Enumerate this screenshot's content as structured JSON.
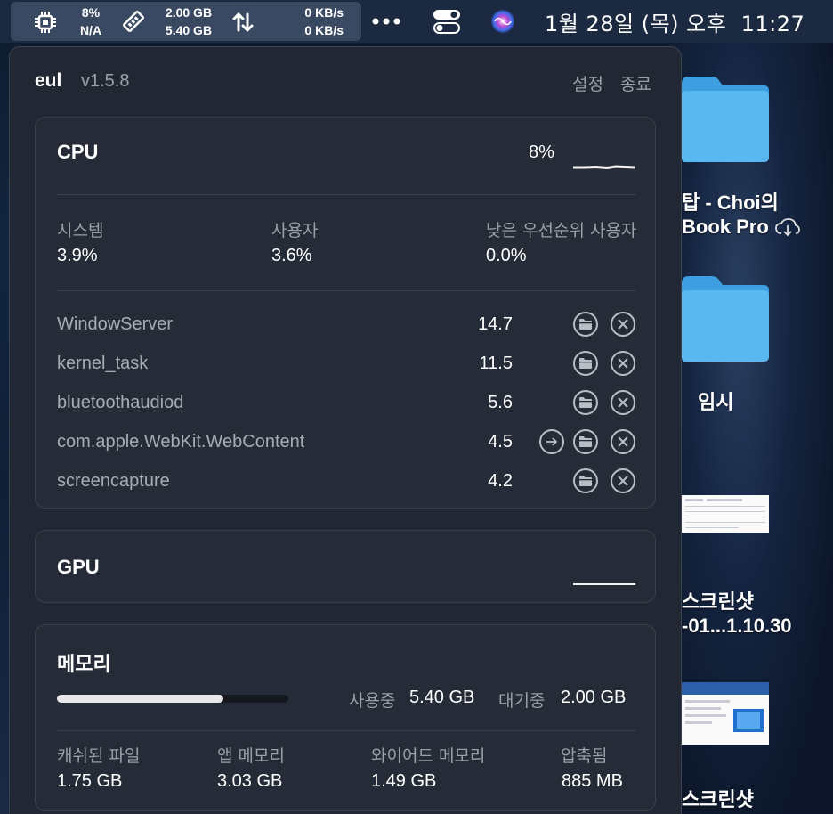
{
  "menubar": {
    "cpu_percent": "8%",
    "battery": "N/A",
    "memory_used": "2.00 GB",
    "memory_total": "5.40 GB",
    "net_up": "0 KB/s",
    "net_down": "0 KB/s",
    "clock": "1월 28일 (목) 오후  11:27"
  },
  "panel": {
    "app_name": "eul",
    "version": "v1.5.8",
    "settings_label": "설정",
    "quit_label": "종료"
  },
  "cpu": {
    "title": "CPU",
    "usage": "8%",
    "system_label": "시스템",
    "system_value": "3.9%",
    "user_label": "사용자",
    "user_value": "3.6%",
    "nice_label": "낮은 우선순위 사용자",
    "nice_value": "0.0%",
    "processes": [
      {
        "name": "WindowServer",
        "value": "14.7"
      },
      {
        "name": "kernel_task",
        "value": "11.5"
      },
      {
        "name": "bluetoothaudiod",
        "value": "5.6"
      },
      {
        "name": "com.apple.WebKit.WebContent",
        "value": "4.5"
      },
      {
        "name": "screencapture",
        "value": "4.2"
      }
    ]
  },
  "gpu": {
    "title": "GPU"
  },
  "memory": {
    "title": "메모리",
    "used_fraction": 0.72,
    "in_use_label": "사용중",
    "in_use_value": "5.40 GB",
    "standby_label": "대기중",
    "standby_value": "2.00 GB",
    "cached_label": "캐쉬된 파일",
    "cached_value": "1.75 GB",
    "app_label": "앱 메모리",
    "app_value": "3.03 GB",
    "wired_label": "와이어드 메모리",
    "wired_value": "1.49 GB",
    "compressed_label": "압축됨",
    "compressed_value": "885 MB"
  },
  "desktop": {
    "item1_line1": "탑 - Choi의",
    "item1_line2": "Book Pro",
    "item2_label": "임시",
    "item3_line1": "스크린샷",
    "item3_line2": "-01...1.10.30",
    "item4_line1": "스크린샷"
  },
  "colors": {
    "panel_bg": "#222833",
    "card_bg": "#262c37",
    "folder_blue": "#5ab8f0"
  }
}
